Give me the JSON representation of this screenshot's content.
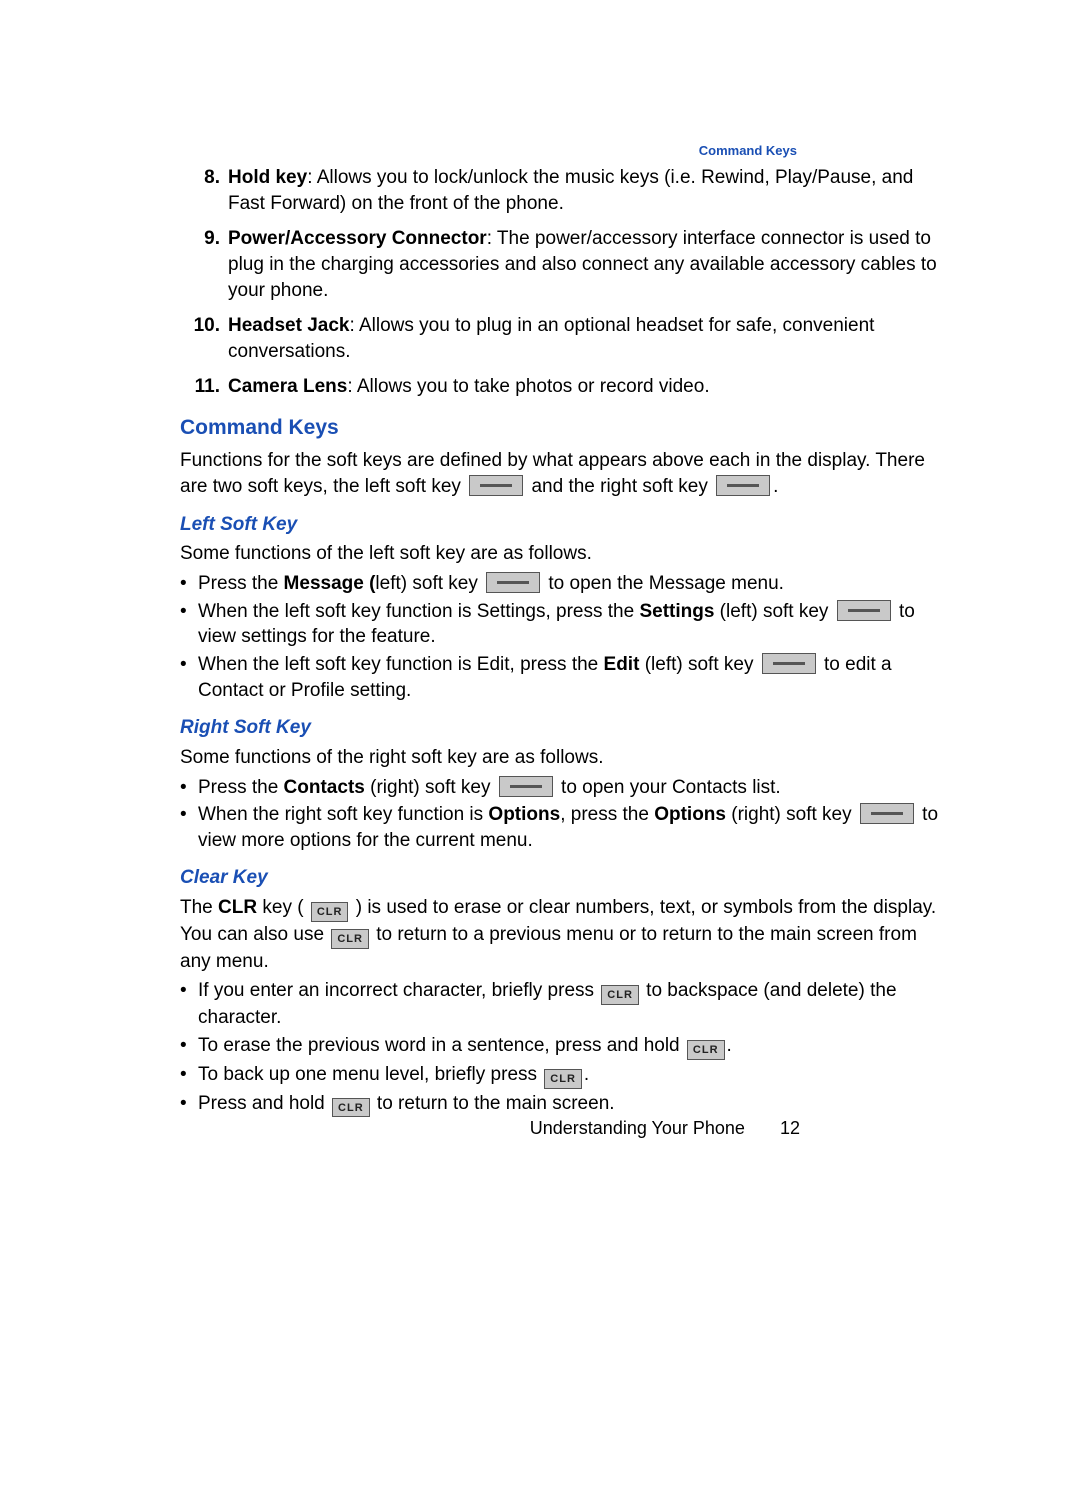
{
  "header_tag": "Command Keys",
  "numlist": [
    {
      "n": "8.",
      "label": "Hold key",
      "text": ": Allows you to lock/unlock the music keys (i.e. Rewind, Play/Pause, and Fast Forward) on the front of the phone."
    },
    {
      "n": "9.",
      "label": "Power/Accessory Connector",
      "text": ": The power/accessory interface connector is used to plug in the charging accessories and also connect any available accessory cables to your phone."
    },
    {
      "n": "10.",
      "label": "Headset Jack",
      "text": ": Allows you to plug in an optional headset for safe, convenient conversations."
    },
    {
      "n": "11.",
      "label": "Camera Lens",
      "text": ": Allows you to take photos or record video."
    }
  ],
  "h1": "Command Keys",
  "intro1": "Functions for the soft keys are defined by what appears above each in the display. There are two soft keys, the left soft key ",
  "intro2": " and the right soft key ",
  "period": ".",
  "left": {
    "h": "Left Soft Key",
    "intro": "Some functions of the left soft key are as follows.",
    "b1a": "Press the ",
    "b1b": "Message (",
    "b1c": "left) soft key ",
    "b1d": " to open the Message menu.",
    "b2a": "When the left soft key function is Settings, press the ",
    "b2b": "Settings",
    "b2c": " (left) soft key ",
    "b2d": " to view settings for the feature.",
    "b3a": "When the left soft key function is Edit, press the ",
    "b3b": "Edit",
    "b3c": " (left) soft key ",
    "b3d": " to edit a Contact or Profile setting."
  },
  "right": {
    "h": "Right Soft Key",
    "intro": "Some functions of the right soft key are as follows.",
    "b1a": "Press the ",
    "b1b": "Contacts",
    "b1c": " (right) soft key ",
    "b1d": " to open your Contacts list.",
    "b2a": "When the right soft key function is ",
    "b2b": "Options",
    "b2c": ", press the ",
    "b2d": "Options",
    "b2e": " (right) soft key ",
    "b2f": " to view more options for the current menu."
  },
  "clear": {
    "h": "Clear Key",
    "p1a": "The ",
    "p1b": "CLR",
    "p1c": " key ( ",
    "clr_label": "CLR",
    "p1d": " ) is used to erase or clear numbers, text, or symbols from the display. You can also use ",
    "p1e": " to return to a previous menu or to return to the main screen from any menu.",
    "b1a": "If you enter an incorrect character, briefly press ",
    "b1b": " to backspace (and delete) the character.",
    "b2a": "To erase the previous word in a sentence, press and hold ",
    "b3a": "To back up one menu level, briefly press ",
    "b4a": "Press and hold ",
    "b4b": " to return to the main screen."
  },
  "footer": {
    "section": "Understanding Your Phone",
    "page": "12"
  }
}
